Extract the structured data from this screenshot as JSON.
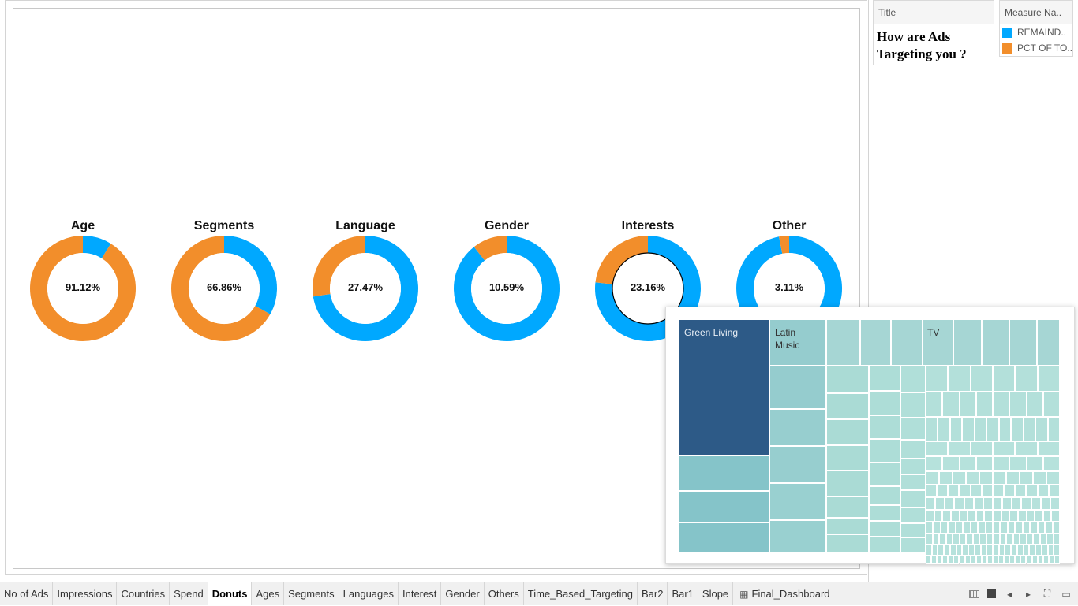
{
  "colors": {
    "remainder": "#00A8FF",
    "pct": "#F28E2B",
    "treemap_highlight": "#2D5A87",
    "treemap_mid": "#85C4C9",
    "treemap_light": "#A8D8D6"
  },
  "title_card": {
    "header": "Title",
    "text": "How are Ads Targeting you ?"
  },
  "legend": {
    "header": "Measure Na..",
    "items": [
      {
        "label": "REMAIND..",
        "color": "#00A8FF"
      },
      {
        "label": "PCT OF TO..",
        "color": "#F28E2B"
      }
    ]
  },
  "chart_data": [
    {
      "type": "pie",
      "title": "Age",
      "label": "91.12%",
      "values": [
        91.12,
        8.88
      ]
    },
    {
      "type": "pie",
      "title": "Segments",
      "label": "66.86%",
      "values": [
        66.86,
        33.14
      ]
    },
    {
      "type": "pie",
      "title": "Language",
      "label": "27.47%",
      "values": [
        27.47,
        72.53
      ]
    },
    {
      "type": "pie",
      "title": "Gender",
      "label": "10.59%",
      "values": [
        10.59,
        89.41
      ]
    },
    {
      "type": "pie",
      "title": "Interests",
      "label": "23.16%",
      "values": [
        23.16,
        76.84
      ],
      "selected": true
    },
    {
      "type": "pie",
      "title": "Other",
      "label": "3.11%",
      "values": [
        3.11,
        96.89
      ]
    }
  ],
  "treemap": {
    "labels": [
      "Green Living",
      "Latin Music",
      "TV"
    ]
  },
  "tabs": [
    "No of Ads",
    "Impressions",
    "Countries",
    "Spend",
    "Donuts",
    "Ages",
    "Segments",
    "Languages",
    "Interest",
    "Gender",
    "Others",
    "Time_Based_Targeting",
    "Bar2",
    "Bar1",
    "Slope",
    "Final_Dashboard"
  ],
  "active_tab": "Donuts"
}
